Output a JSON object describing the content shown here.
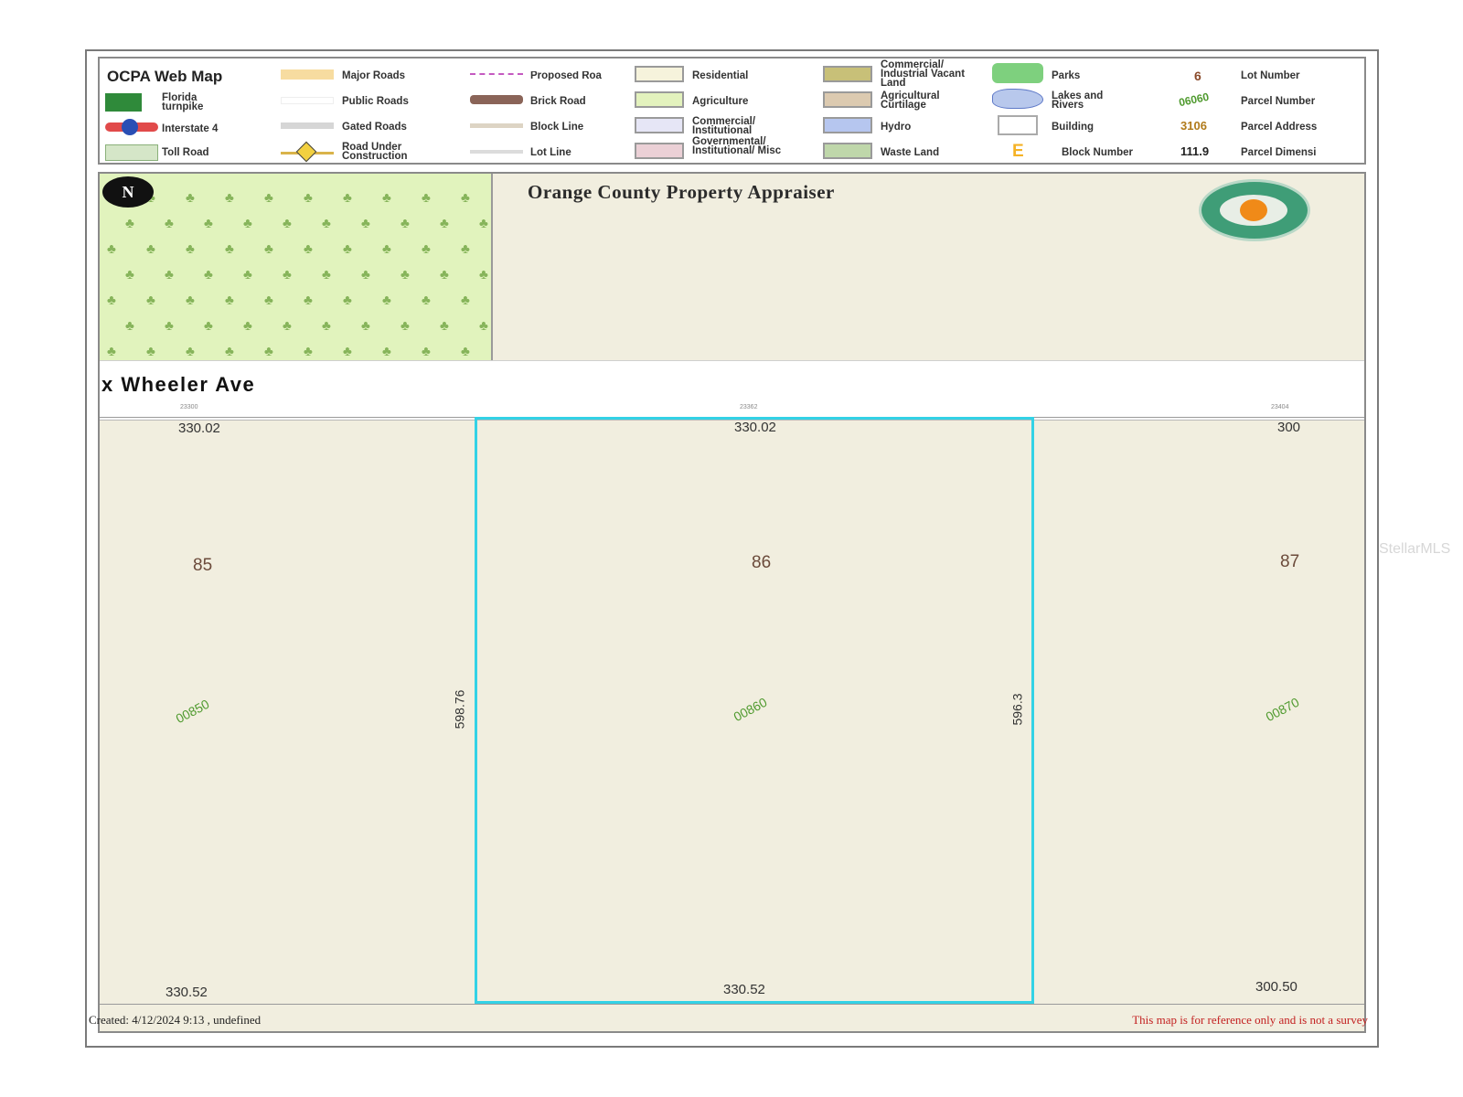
{
  "legend": {
    "title": "OCPA Web Map",
    "col1": [
      "Florida turnpike",
      "Interstate 4",
      "Toll Road"
    ],
    "col2": [
      "Major Roads",
      "Public Roads",
      "Gated Roads",
      "Road Under Construction"
    ],
    "col3": [
      "Proposed Roa",
      "Brick Road",
      "Block Line",
      "Lot Line"
    ],
    "col4": [
      "Residential",
      "Agriculture",
      "Commercial/ Institutional",
      "Governmental/ Institutional/ Misc"
    ],
    "col5": [
      "Commercial/ Industrial Vacant Land",
      "Agricultural Curtilage",
      "Hydro",
      "Waste Land"
    ],
    "col6": [
      "Parks",
      "Lakes and Rivers",
      "Building",
      "Block Number"
    ],
    "col7_values": [
      "6",
      "06060",
      "3106",
      "111.9"
    ],
    "block_symbol": "E",
    "col7_labels": [
      "Lot Number",
      "Parcel Number",
      "Parcel Address",
      "Parcel Dimensi"
    ],
    "swatch_colors": {
      "major_roads": "#f7dca0",
      "proposed": "#c45ac0",
      "brick": "#8a6458",
      "residential": "#f6f3dc",
      "agriculture": "#e3f2bd",
      "commercial": "#e6e6f6",
      "governmental": "#ebd0d6",
      "comm_vacant": "#c8c078",
      "ag_curtilage": "#dccab0",
      "hydro": "#b6c6ef",
      "waste": "#bfd7aa",
      "parks": "#7ed07e",
      "lakes": "#b8c8ec"
    }
  },
  "map": {
    "title": "Orange County Property Appraiser",
    "north_label": "N",
    "road_name": "x  Wheeler  Ave",
    "addresses": [
      "23300",
      "23362",
      "23404"
    ],
    "top_dims": [
      "330.02",
      "330.02",
      "300"
    ],
    "bottom_dims": [
      "330.52",
      "330.52",
      "300.50"
    ],
    "lots": [
      "85",
      "86",
      "87"
    ],
    "parcel_numbers": [
      "00850",
      "00860",
      "00870"
    ],
    "side_dims": [
      "598.76",
      "596.3"
    ],
    "footer_created": "Created: 4/12/2024 9:13   , undefined",
    "footer_disclaimer": "This map is for reference only and is not a survey",
    "highlight_color": "#33d2e6"
  },
  "watermark": "StellarMLS"
}
